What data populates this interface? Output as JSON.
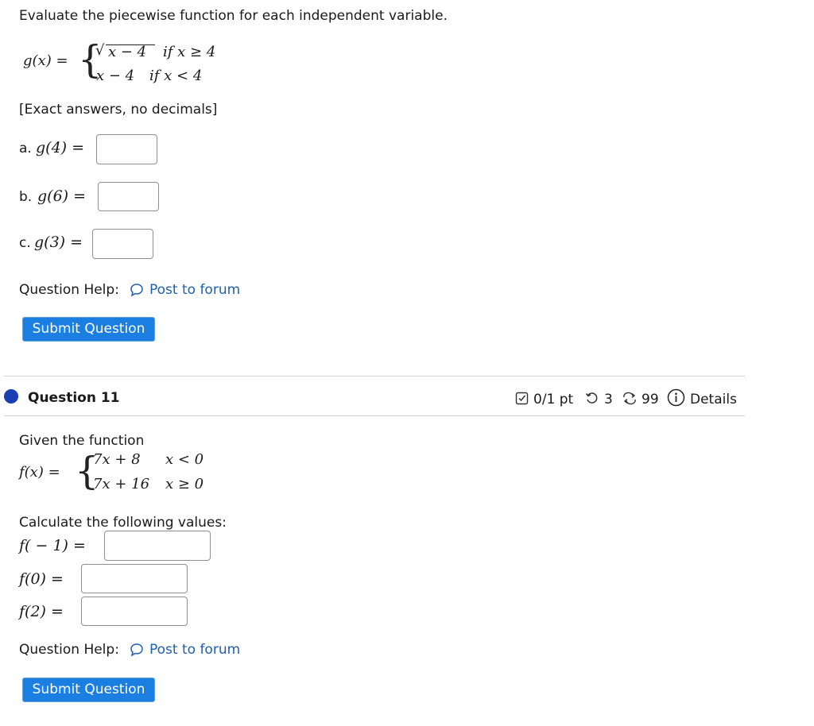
{
  "q10": {
    "instruction": "Evaluate the piecewise function for each independent variable.",
    "func_name": "g(x) =",
    "case1_expr": "x − 4",
    "case1_cond": "if  x ≥ 4",
    "case2_expr": "x − 4",
    "case2_cond": "if  x < 4",
    "note": "[Exact answers, no decimals]",
    "part_a_prefix": "a.",
    "part_a_expr": "g(4) =",
    "part_b_prefix": "b.",
    "part_b_expr": "g(6) =",
    "part_c_prefix": "c.",
    "part_c_expr": "g(3) =",
    "help_label": "Question Help:",
    "forum_link": "Post to forum",
    "submit_label": "Submit Question"
  },
  "q11": {
    "title": "Question 11",
    "score": "0/1 pt",
    "retries": "3",
    "attempts": "99",
    "details": "Details",
    "intro": "Given the function",
    "func_name": "f(x) =",
    "case1_expr": "7x + 8",
    "case1_cond": "x < 0",
    "case2_expr": "7x + 16",
    "case2_cond": "x ≥ 0",
    "calc_label": "Calculate the following values:",
    "val1": "f( − 1) =",
    "val2": "f(0) =",
    "val3": "f(2) =",
    "help_label": "Question Help:",
    "forum_link": "Post to forum",
    "submit_label": "Submit Question"
  },
  "colors": {
    "accent": "#1a7fe0",
    "link": "#1f5fae",
    "question_dot": "#1a3fb5"
  }
}
